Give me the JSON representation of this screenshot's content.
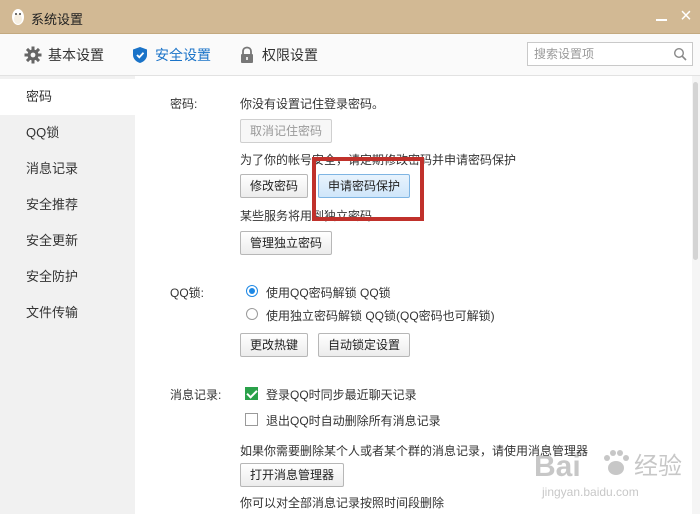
{
  "window": {
    "title": "系统设置"
  },
  "tabs": [
    {
      "label": "基本设置",
      "icon": "gear-icon"
    },
    {
      "label": "安全设置",
      "icon": "shield-icon"
    },
    {
      "label": "权限设置",
      "icon": "lock-icon"
    }
  ],
  "search": {
    "placeholder": "搜索设置项"
  },
  "sidebar": {
    "items": [
      {
        "label": "密码"
      },
      {
        "label": "QQ锁"
      },
      {
        "label": "消息记录"
      },
      {
        "label": "安全推荐"
      },
      {
        "label": "安全更新"
      },
      {
        "label": "安全防护"
      },
      {
        "label": "文件传输"
      }
    ]
  },
  "password": {
    "label": "密码:",
    "no_saved": "你没有设置记住登录密码。",
    "cancel_remember_button": "取消记住密码",
    "tip": "为了你的帐号安全，请定期修改密码并申请密码保护",
    "change_button": "修改密码",
    "apply_protect_button": "申请密码保护",
    "independent_tip": "某些服务将用到独立密码",
    "manage_independent_button": "管理独立密码"
  },
  "qqlock": {
    "label": "QQ锁:",
    "option1": "使用QQ密码解锁 QQ锁",
    "option2": "使用独立密码解锁 QQ锁(QQ密码也可解锁)",
    "hotkey_button": "更改热键",
    "autolock_button": "自动锁定设置"
  },
  "messages": {
    "label": "消息记录:",
    "sync_option": "登录QQ时同步最近聊天记录",
    "delete_option": "退出QQ时自动删除所有消息记录",
    "tip": "如果你需要删除某个人或者某个群的消息记录，请使用消息管理器",
    "open_manager_button": "打开消息管理器",
    "time_delete_tip": "你可以对全部消息记录按照时间段删除"
  },
  "watermark": {
    "text1": "Bai",
    "text2": "经验",
    "url": "jingyan.baidu.com"
  },
  "colors": {
    "accent": "#1a73c8",
    "titlebar": "#d2b994",
    "highlight_box": "#c0312b",
    "check": "#2aa14a"
  }
}
